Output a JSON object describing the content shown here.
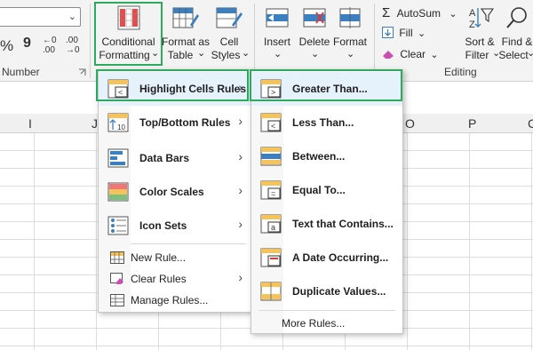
{
  "ribbon": {
    "number_format_value": "",
    "number_symbols": {
      "percent": "%",
      "comma": "9",
      "inc_decimal": "←0 .00",
      "dec_decimal": ".00 →0"
    },
    "number_group_label": "Number",
    "conditional_formatting": {
      "line1": "Conditional",
      "line2": "Formatting",
      "caret": "⌄"
    },
    "format_as_table": {
      "line1": "Format as",
      "line2": "Table",
      "caret": "⌄"
    },
    "cell_styles": {
      "line1": "Cell",
      "line2": "Styles",
      "caret": "⌄"
    },
    "insert": {
      "label": "Insert",
      "caret": "⌄"
    },
    "delete": {
      "label": "Delete",
      "caret": "⌄"
    },
    "format": {
      "label": "Format",
      "caret": "⌄"
    },
    "autosum": {
      "symbol": "Σ",
      "label": "AutoSum",
      "caret": "⌄"
    },
    "fill": {
      "label": "Fill",
      "caret": "⌄"
    },
    "clear": {
      "label": "Clear",
      "caret": "⌄"
    },
    "sort_filter": {
      "line1": "Sort &",
      "line2": "Filter",
      "caret": "⌄"
    },
    "find_select": {
      "line1": "Find &",
      "line2": "Select",
      "caret": "⌄"
    },
    "editing_group_label": "Editing",
    "dialog_launcher_icon": "dialog-launcher-icon"
  },
  "columns": [
    "I",
    "J",
    "O",
    "P",
    "C"
  ],
  "menu_main": {
    "items": [
      {
        "label": "Highlight Cells Rules",
        "arrow": "›"
      },
      {
        "label": "Top/Bottom Rules",
        "arrow": "›"
      },
      {
        "label": "Data Bars",
        "arrow": "›"
      },
      {
        "label": "Color Scales",
        "arrow": "›"
      },
      {
        "label": "Icon Sets",
        "arrow": "›"
      },
      {
        "label": "New Rule...",
        "arrow": ""
      },
      {
        "label": "Clear Rules",
        "arrow": "›"
      },
      {
        "label": "Manage Rules...",
        "arrow": ""
      }
    ]
  },
  "menu_sub": {
    "items": [
      {
        "label": "Greater Than..."
      },
      {
        "label": "Less Than..."
      },
      {
        "label": "Between..."
      },
      {
        "label": "Equal To..."
      },
      {
        "label": "Text that Contains..."
      },
      {
        "label": "A Date Occurring..."
      },
      {
        "label": "Duplicate Values..."
      }
    ],
    "more_rules": "More Rules..."
  },
  "colors": {
    "highlight_border": "#2eaa5c",
    "selected_bg": "#e5f1fb",
    "ribbon_bg": "#f3f3f3"
  }
}
